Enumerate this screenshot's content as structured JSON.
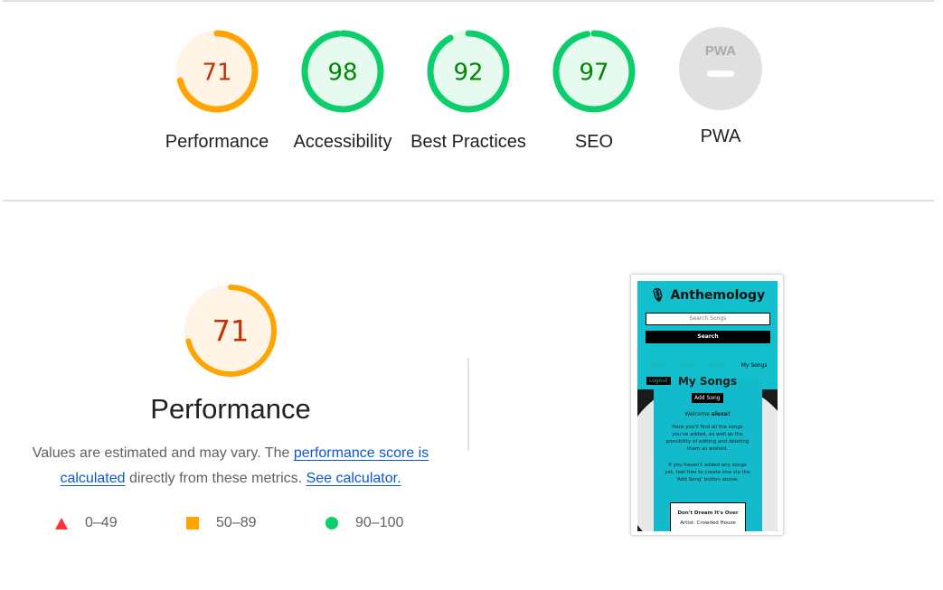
{
  "colors": {
    "fail": "#ff3333",
    "average": "#ffa400",
    "pass": "#0cce6b",
    "avg_text": "#c33300",
    "pass_text": "#008800"
  },
  "categories": [
    {
      "label": "Performance",
      "score": 71
    },
    {
      "label": "Accessibility",
      "score": 98
    },
    {
      "label": "Best Practices",
      "score": 92
    },
    {
      "label": "SEO",
      "score": 97
    },
    {
      "label": "PWA",
      "badge": "PWA"
    }
  ],
  "perf": {
    "score": 71,
    "title": "Performance",
    "desc_before": "Values are estimated and may vary. The ",
    "link1": "performance score is calculated",
    "desc_mid": " directly from these metrics. ",
    "link2": "See calculator."
  },
  "legend": [
    {
      "range": "0–49"
    },
    {
      "range": "50–89"
    },
    {
      "range": "90–100"
    }
  ],
  "screenshot": {
    "app": "Anthemology",
    "search_placeholder": "Search Songs",
    "search_btn": "Search",
    "nav": [
      "Home",
      "Songs",
      "About",
      "My Songs"
    ],
    "logout": "Logout",
    "heading": "My Songs",
    "add": "Add Song",
    "welcome": "Welcome",
    "user": "alexa!",
    "p1": "Here you'll find all the songs you've added, as well as the possibility of editing and deleting them as wished.",
    "p2": "If you haven't added any songs yet, feel free to create one via the 'Add Song' button above.",
    "song": "Don't Dream It's Over",
    "artist": "Artist: Crowded House"
  }
}
